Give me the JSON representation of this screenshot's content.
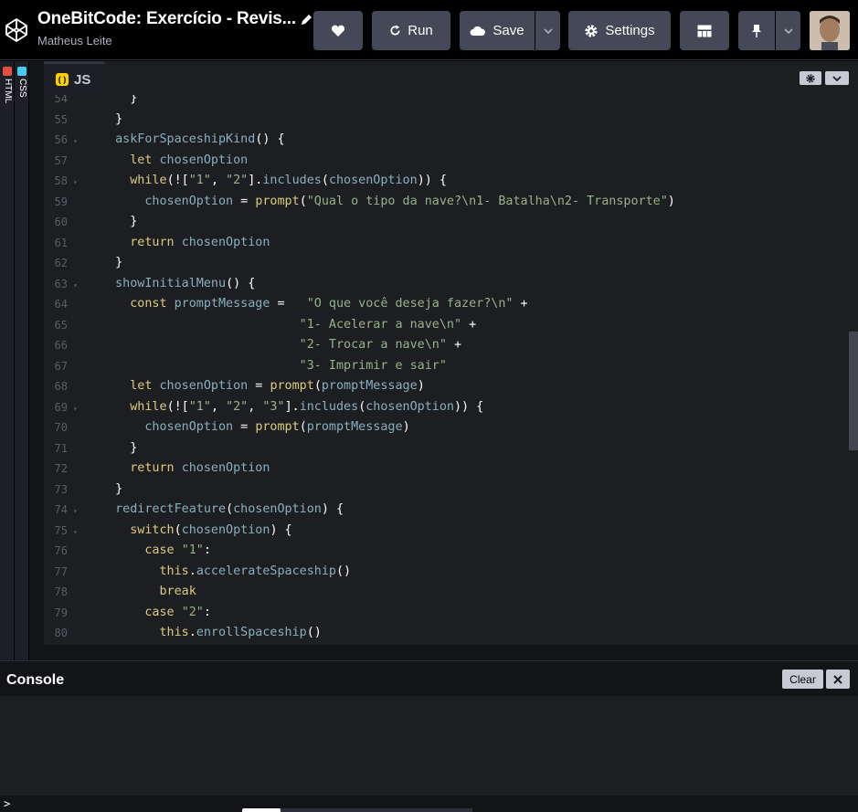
{
  "header": {
    "title": "OneBitCode: Exercício - Revis...",
    "author": "Matheus Leite",
    "buttons": {
      "run": "Run",
      "save": "Save",
      "settings": "Settings"
    }
  },
  "side_tabs": {
    "html": "HTML",
    "css": "CSS"
  },
  "editor": {
    "tab": "JS",
    "tab_badge": "( )",
    "lines": [
      {
        "n": "54",
        "fold": false
      },
      {
        "n": "55",
        "fold": false
      },
      {
        "n": "56",
        "fold": true
      },
      {
        "n": "57",
        "fold": false
      },
      {
        "n": "58",
        "fold": true
      },
      {
        "n": "59",
        "fold": false
      },
      {
        "n": "60",
        "fold": false
      },
      {
        "n": "61",
        "fold": false
      },
      {
        "n": "62",
        "fold": false
      },
      {
        "n": "63",
        "fold": true
      },
      {
        "n": "64",
        "fold": false
      },
      {
        "n": "65",
        "fold": false
      },
      {
        "n": "66",
        "fold": false
      },
      {
        "n": "67",
        "fold": false
      },
      {
        "n": "68",
        "fold": false
      },
      {
        "n": "69",
        "fold": true
      },
      {
        "n": "70",
        "fold": false
      },
      {
        "n": "71",
        "fold": false
      },
      {
        "n": "72",
        "fold": false
      },
      {
        "n": "73",
        "fold": false
      },
      {
        "n": "74",
        "fold": true
      },
      {
        "n": "75",
        "fold": true
      },
      {
        "n": "76",
        "fold": false
      },
      {
        "n": "77",
        "fold": false
      },
      {
        "n": "78",
        "fold": false
      },
      {
        "n": "79",
        "fold": false
      },
      {
        "n": "80",
        "fold": false
      }
    ],
    "code": [
      [
        [
          "pl",
          "    }"
        ]
      ],
      [
        [
          "pl",
          "  }"
        ]
      ],
      [
        [
          "pl",
          "  "
        ],
        [
          "var",
          "askForSpaceshipKind"
        ],
        [
          "pl",
          "() {"
        ]
      ],
      [
        [
          "pl",
          "    "
        ],
        [
          "kw",
          "let"
        ],
        [
          "pl",
          " "
        ],
        [
          "var",
          "chosenOption"
        ]
      ],
      [
        [
          "pl",
          "    "
        ],
        [
          "kw",
          "while"
        ],
        [
          "pl",
          "(!["
        ],
        [
          "str",
          "\"1\""
        ],
        [
          "pl",
          ", "
        ],
        [
          "str",
          "\"2\""
        ],
        [
          "pl",
          "]."
        ],
        [
          "var",
          "includes"
        ],
        [
          "pl",
          "("
        ],
        [
          "var",
          "chosenOption"
        ],
        [
          "pl",
          ")) {"
        ]
      ],
      [
        [
          "pl",
          "      "
        ],
        [
          "var",
          "chosenOption"
        ],
        [
          "pl",
          " = "
        ],
        [
          "fn",
          "prompt"
        ],
        [
          "pl",
          "("
        ],
        [
          "str",
          "\"Qual o tipo da nave?\\n1- Batalha\\n2- Transporte\""
        ],
        [
          "pl",
          ")"
        ]
      ],
      [
        [
          "pl",
          "    }"
        ]
      ],
      [
        [
          "pl",
          "    "
        ],
        [
          "kw",
          "return"
        ],
        [
          "pl",
          " "
        ],
        [
          "var",
          "chosenOption"
        ]
      ],
      [
        [
          "pl",
          "  }"
        ]
      ],
      [
        [
          "pl",
          "  "
        ],
        [
          "var",
          "showInitialMenu"
        ],
        [
          "pl",
          "() {"
        ]
      ],
      [
        [
          "pl",
          "    "
        ],
        [
          "kw",
          "const"
        ],
        [
          "pl",
          " "
        ],
        [
          "var",
          "promptMessage"
        ],
        [
          "pl",
          " =   "
        ],
        [
          "str",
          "\"O que você deseja fazer?\\n\""
        ],
        [
          "pl",
          " +"
        ]
      ],
      [
        [
          "pl",
          "                           "
        ],
        [
          "str",
          "\"1- Acelerar a nave\\n\""
        ],
        [
          "pl",
          " +"
        ]
      ],
      [
        [
          "pl",
          "                           "
        ],
        [
          "str",
          "\"2- Trocar a nave\\n\""
        ],
        [
          "pl",
          " +"
        ]
      ],
      [
        [
          "pl",
          "                           "
        ],
        [
          "str",
          "\"3- Imprimir e sair\""
        ]
      ],
      [
        [
          "pl",
          "    "
        ],
        [
          "kw",
          "let"
        ],
        [
          "pl",
          " "
        ],
        [
          "var",
          "chosenOption"
        ],
        [
          "pl",
          " = "
        ],
        [
          "fn",
          "prompt"
        ],
        [
          "pl",
          "("
        ],
        [
          "var",
          "promptMessage"
        ],
        [
          "pl",
          ")"
        ]
      ],
      [
        [
          "pl",
          "    "
        ],
        [
          "kw",
          "while"
        ],
        [
          "pl",
          "(!["
        ],
        [
          "str",
          "\"1\""
        ],
        [
          "pl",
          ", "
        ],
        [
          "str",
          "\"2\""
        ],
        [
          "pl",
          ", "
        ],
        [
          "str",
          "\"3\""
        ],
        [
          "pl",
          "]."
        ],
        [
          "var",
          "includes"
        ],
        [
          "pl",
          "("
        ],
        [
          "var",
          "chosenOption"
        ],
        [
          "pl",
          ")) {"
        ]
      ],
      [
        [
          "pl",
          "      "
        ],
        [
          "var",
          "chosenOption"
        ],
        [
          "pl",
          " = "
        ],
        [
          "fn",
          "prompt"
        ],
        [
          "pl",
          "("
        ],
        [
          "var",
          "promptMessage"
        ],
        [
          "pl",
          ")"
        ]
      ],
      [
        [
          "pl",
          "    }"
        ]
      ],
      [
        [
          "pl",
          "    "
        ],
        [
          "kw",
          "return"
        ],
        [
          "pl",
          " "
        ],
        [
          "var",
          "chosenOption"
        ]
      ],
      [
        [
          "pl",
          "  }"
        ]
      ],
      [
        [
          "pl",
          "  "
        ],
        [
          "var",
          "redirectFeature"
        ],
        [
          "pl",
          "("
        ],
        [
          "var",
          "chosenOption"
        ],
        [
          "pl",
          ") {"
        ]
      ],
      [
        [
          "pl",
          "    "
        ],
        [
          "kw",
          "switch"
        ],
        [
          "pl",
          "("
        ],
        [
          "var",
          "chosenOption"
        ],
        [
          "pl",
          ") {"
        ]
      ],
      [
        [
          "pl",
          "      "
        ],
        [
          "kw",
          "case"
        ],
        [
          "pl",
          " "
        ],
        [
          "str",
          "\"1\""
        ],
        [
          "pl",
          ":"
        ]
      ],
      [
        [
          "pl",
          "        "
        ],
        [
          "kw",
          "this"
        ],
        [
          "pl",
          "."
        ],
        [
          "var",
          "accelerateSpaceship"
        ],
        [
          "pl",
          "()"
        ]
      ],
      [
        [
          "pl",
          "        "
        ],
        [
          "kw",
          "break"
        ]
      ],
      [
        [
          "pl",
          "      "
        ],
        [
          "kw",
          "case"
        ],
        [
          "pl",
          " "
        ],
        [
          "str",
          "\"2\""
        ],
        [
          "pl",
          ":"
        ]
      ],
      [
        [
          "pl",
          "        "
        ],
        [
          "kw",
          "this"
        ],
        [
          "pl",
          "."
        ],
        [
          "var",
          "enrollSpaceship"
        ],
        [
          "pl",
          "()"
        ]
      ]
    ]
  },
  "console": {
    "title": "Console",
    "clear_label": "Clear",
    "prompt": ">"
  },
  "colors": {
    "keyword": "#ddca7e",
    "variable": "#88afbf",
    "string": "#96b38a",
    "button_bg": "#444857",
    "js_badge": "#fcd000"
  }
}
